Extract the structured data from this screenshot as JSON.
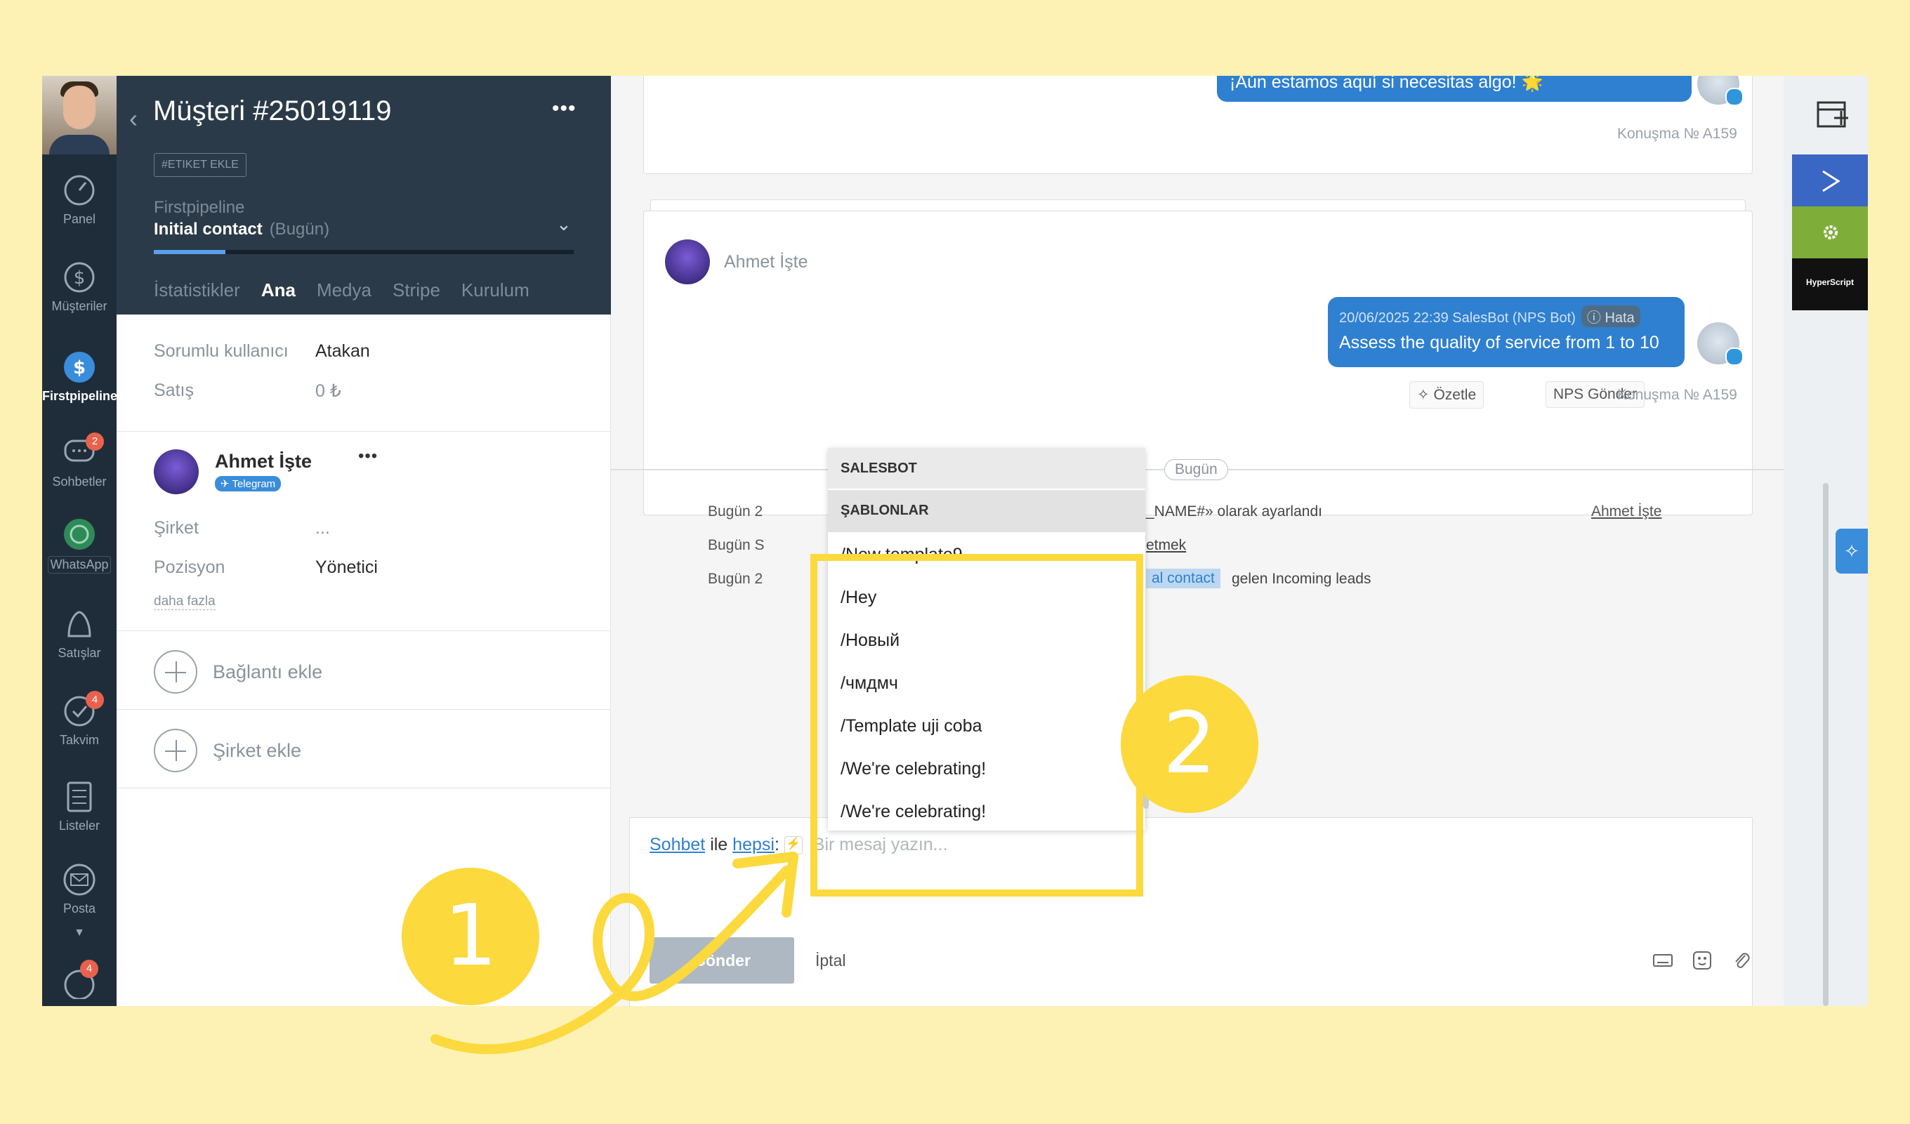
{
  "nav": {
    "items": [
      {
        "label": "Panel",
        "icon": "dashboard-icon"
      },
      {
        "label": "Müşteriler",
        "icon": "dollar-icon"
      },
      {
        "label": "Firstpipeline",
        "icon": "pipeline-icon"
      },
      {
        "label": "Sohbetler",
        "icon": "chat-icon",
        "badge": "2"
      },
      {
        "label": "WhatsApp",
        "icon": "whatsapp-icon"
      },
      {
        "label": "Satışlar",
        "icon": "sales-icon"
      },
      {
        "label": "Takvim",
        "icon": "calendar-icon",
        "badge": "4"
      },
      {
        "label": "Listeler",
        "icon": "list-icon"
      },
      {
        "label": "Posta",
        "icon": "mail-icon"
      }
    ],
    "bottom_badge": "4"
  },
  "customer": {
    "title": "Müşteri #25019119",
    "tag_button": "#ETIKET EKLE",
    "pipeline_name": "Firstpipeline",
    "stage": "Initial contact",
    "stage_when": "(Bugün)",
    "pipeline_progress": 0.17,
    "tabs": [
      "İstatistikler",
      "Ana",
      "Medya",
      "Stripe",
      "Kurulum"
    ],
    "active_tab": "Ana",
    "fields": [
      {
        "label": "Sorumlu kullanıcı",
        "value": "Atakan"
      },
      {
        "label": "Satış",
        "value": "0 ₺"
      }
    ],
    "contact": {
      "name": "Ahmet İşte",
      "channel": "Telegram",
      "fields": [
        {
          "label": "Şirket",
          "value": "..."
        },
        {
          "label": "Pozisyon",
          "value": "Yönetici"
        }
      ],
      "more": "daha fazla"
    },
    "add_connection": "Bağlantı ekle",
    "add_company": "Şirket ekle"
  },
  "chat": {
    "top_message": "¡Aún estamos aquí si necesitas algo! 🌟",
    "conv_no_1": "Konuşma № A159",
    "sender": "Ahmet İşte",
    "bot_meta": "20/06/2025 22:39 SalesBot (NPS Bot)",
    "error_tag": "ⓘ Hata",
    "bot_message": "Assess the quality of service from 1 to 10",
    "summarize_btn": "Özetle",
    "nps_btn": "NPS Gönder",
    "conv_no_2": "Konuşma № A159",
    "day_divider": "Bugün",
    "events": [
      {
        "left": "Bugün 2",
        "right": "_NAME#» olarak ayarlandı"
      },
      {
        "left": "Bugün S",
        "right": "etmek"
      },
      {
        "left": "Bugün 2",
        "right_highlight": "al contact",
        "right": "gelen Incoming leads"
      }
    ],
    "event_link": "Ahmet İşte"
  },
  "dropdown": {
    "section1": "SALESBOT",
    "section2": "ŞABLONLAR",
    "items": [
      "/New template9",
      "/Hey",
      "/Новый",
      "/чмдмч",
      "/Template uji coba",
      "/We're celebrating!",
      "/We're celebrating!"
    ]
  },
  "composer": {
    "link1": "Sohbet",
    "mid": "ile",
    "link2": "hepsi",
    "colon": ":",
    "placeholder": "Bir mesaj yazın...",
    "send": "Gönder",
    "cancel": "İptal"
  },
  "right_bar": {
    "hyper_label": "HyperScript"
  },
  "callouts": [
    "1",
    "2"
  ],
  "colors": {
    "background": "#fdf2b4",
    "highlight": "#fcd93d",
    "sidebar": "#1f2d3a",
    "accent_blue": "#2f80d1",
    "green": "#7ead3a"
  }
}
